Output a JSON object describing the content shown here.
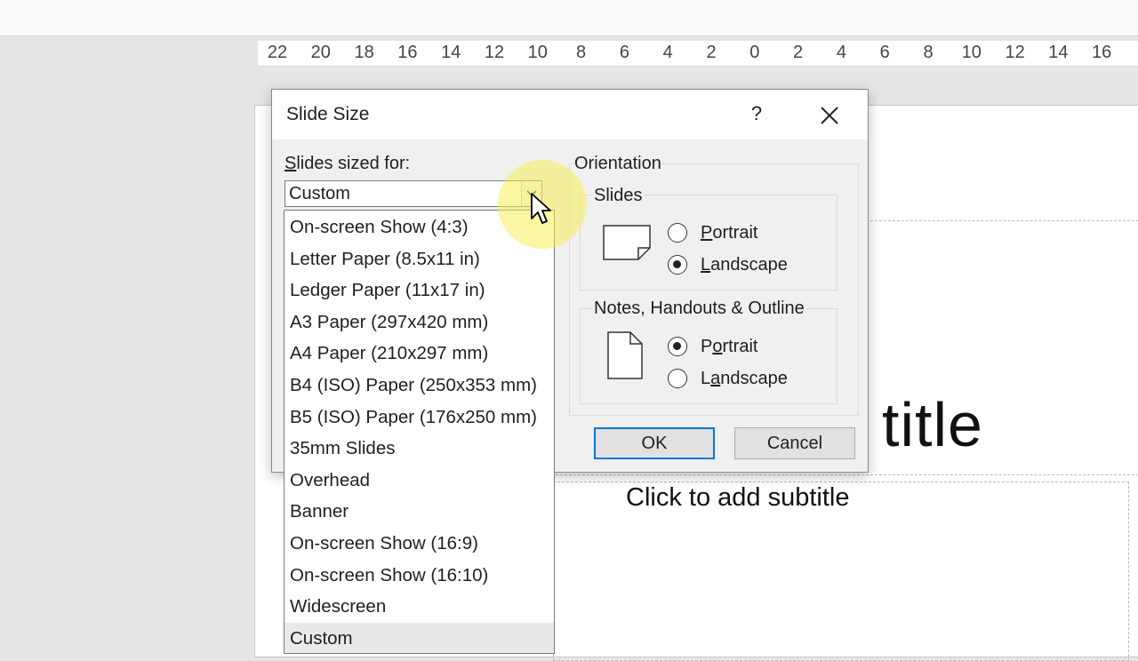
{
  "ruler": {
    "ticks": [
      "22",
      "20",
      "18",
      "16",
      "14",
      "12",
      "10",
      "8",
      "6",
      "4",
      "2",
      "0",
      "2",
      "4",
      "6",
      "8",
      "10",
      "12",
      "14",
      "16"
    ]
  },
  "slide": {
    "title_placeholder": "title",
    "subtitle_placeholder": "Click to add subtitle"
  },
  "dialog": {
    "title": "Slide Size",
    "help": "?",
    "sized_for_label_accel": "S",
    "sized_for_label_rest": "lides sized for:",
    "combo_value": "Custom",
    "orientation_label": "Orientation",
    "slides_group": {
      "label": "Slides",
      "portrait_accel": "P",
      "portrait_rest": "ortrait",
      "landscape_accel": "L",
      "landscape_rest": "andscape",
      "selected": "Landscape"
    },
    "notes_group": {
      "label": "Notes, Handouts & Outline",
      "portrait_pre": "P",
      "portrait_accel": "o",
      "portrait_rest": "rtrait",
      "landscape_pre": "L",
      "landscape_accel": "a",
      "landscape_rest": "ndscape",
      "selected": "Portrait"
    },
    "ok_label": "OK",
    "cancel_label": "Cancel"
  },
  "dropdown": {
    "items": [
      "On-screen Show (4:3)",
      "Letter Paper (8.5x11 in)",
      "Ledger Paper (11x17 in)",
      "A3 Paper (297x420 mm)",
      "A4 Paper (210x297 mm)",
      "B4 (ISO) Paper (250x353 mm)",
      "B5 (ISO) Paper (176x250 mm)",
      "35mm Slides",
      "Overhead",
      "Banner",
      "On-screen Show (16:9)",
      "On-screen Show (16:10)",
      "Widescreen",
      "Custom"
    ],
    "selected": "Custom"
  }
}
